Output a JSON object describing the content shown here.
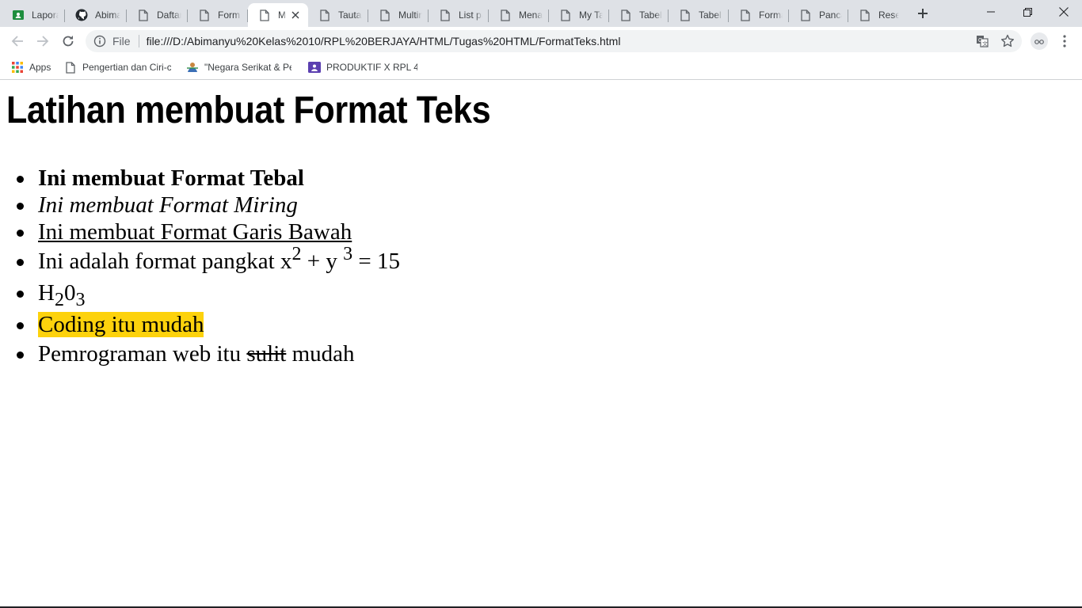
{
  "tabs": [
    {
      "title": "Lapora",
      "icon": "google-classroom-icon"
    },
    {
      "title": "Abima",
      "icon": "github-icon"
    },
    {
      "title": "Daftar",
      "icon": "page-icon"
    },
    {
      "title": "Form C",
      "icon": "page-icon"
    },
    {
      "title": "Me",
      "icon": "page-icon",
      "active": true
    },
    {
      "title": "Tautan",
      "icon": "page-icon"
    },
    {
      "title": "Multim",
      "icon": "page-icon"
    },
    {
      "title": "List pa",
      "icon": "page-icon"
    },
    {
      "title": "Menan",
      "icon": "page-icon"
    },
    {
      "title": "My Tal",
      "icon": "page-icon"
    },
    {
      "title": "Tabel_l",
      "icon": "page-icon"
    },
    {
      "title": "Tabel N",
      "icon": "page-icon"
    },
    {
      "title": "Forma",
      "icon": "page-icon"
    },
    {
      "title": "Pancas",
      "icon": "page-icon"
    },
    {
      "title": "Resep",
      "icon": "page-icon"
    }
  ],
  "omnibox": {
    "scheme_label": "File",
    "url": "file:///D:/Abimanyu%20Kelas%2010/RPL%20BERJAYA/HTML/Tugas%20HTML/FormatTeks.html"
  },
  "bookmarks": [
    {
      "label": "Apps",
      "icon": "apps-grid-icon"
    },
    {
      "label": "Pengertian dan Ciri-c",
      "icon": "page-icon"
    },
    {
      "label": "\"Negara Serikat & Pe",
      "icon": "site-favicon-icon"
    },
    {
      "label": "PRODUKTIF X RPL 4 -",
      "icon": "classroom-icon"
    }
  ],
  "page": {
    "title": "Latihan membuat Format Teks",
    "items": {
      "bold": "Ini membuat Format Tebal",
      "italic": "Ini membuat Format Miring",
      "underline": "Ini membuat Format Garis Bawah",
      "power": {
        "prefix": "Ini adalah format pangkat x",
        "sup1": "2",
        "mid": " + y ",
        "sup2": "3",
        "suffix": " = 15"
      },
      "subscript": {
        "prefix": "H",
        "sub1": "2",
        "mid": "0",
        "sub2": "3"
      },
      "highlight": "Coding itu mudah",
      "strike": {
        "prefix": "Pemrograman web itu ",
        "struck": "sulit",
        "suffix": " mudah"
      }
    },
    "highlight_color": "#fdd20c"
  }
}
